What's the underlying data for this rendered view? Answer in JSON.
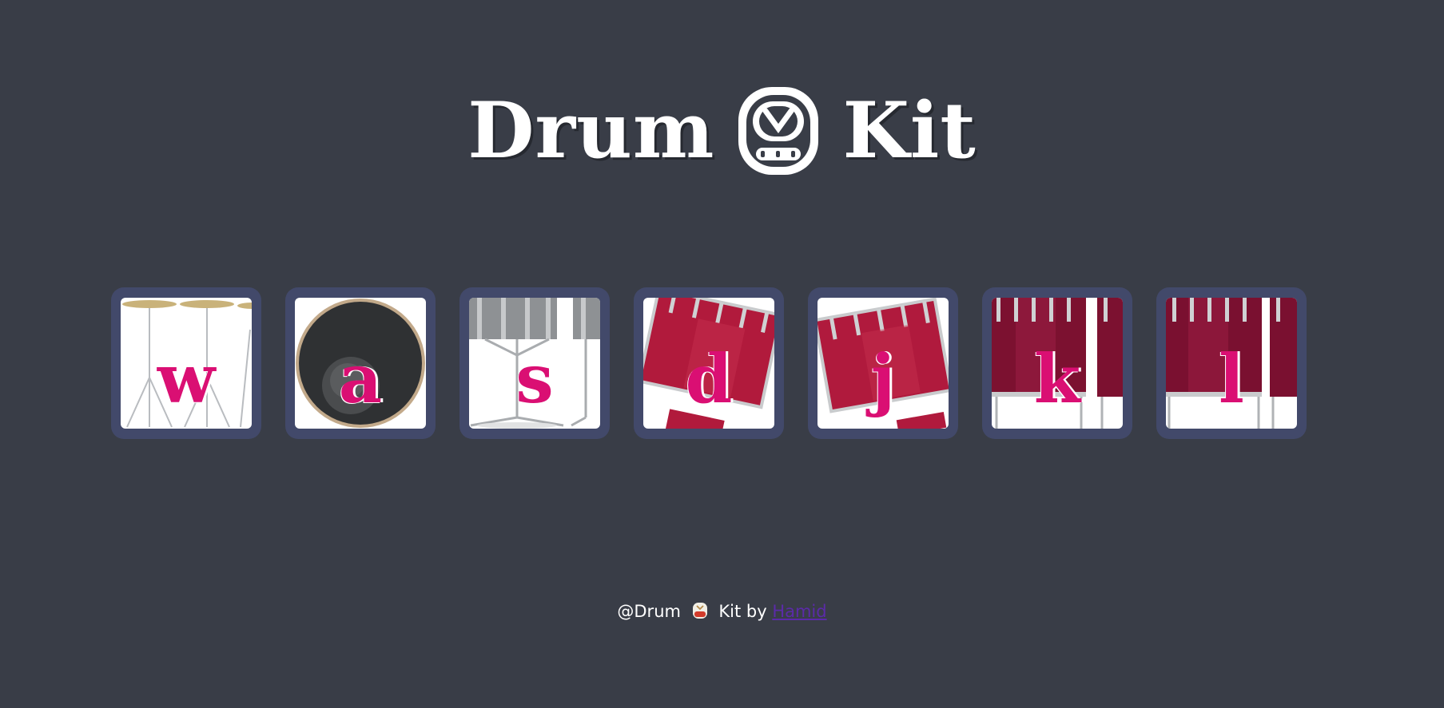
{
  "header": {
    "title_left": "Drum",
    "title_right": "Kit",
    "logo_icon": "drum-face-icon"
  },
  "pads": [
    {
      "key": "w",
      "image": "crash-cymbal"
    },
    {
      "key": "a",
      "image": "kick-drum"
    },
    {
      "key": "s",
      "image": "snare-drum"
    },
    {
      "key": "d",
      "image": "tom-1"
    },
    {
      "key": "j",
      "image": "tom-2"
    },
    {
      "key": "k",
      "image": "tom-3"
    },
    {
      "key": "l",
      "image": "floor-tom"
    }
  ],
  "footer": {
    "prefix": "@Drum",
    "middle": "Kit by",
    "author": "Hamid",
    "emoji_icon": "drum-emoji-icon"
  },
  "colors": {
    "background": "#393d47",
    "pad_frame": "#42496a",
    "letter": "#da0f73",
    "link": "#5b2aa8"
  }
}
